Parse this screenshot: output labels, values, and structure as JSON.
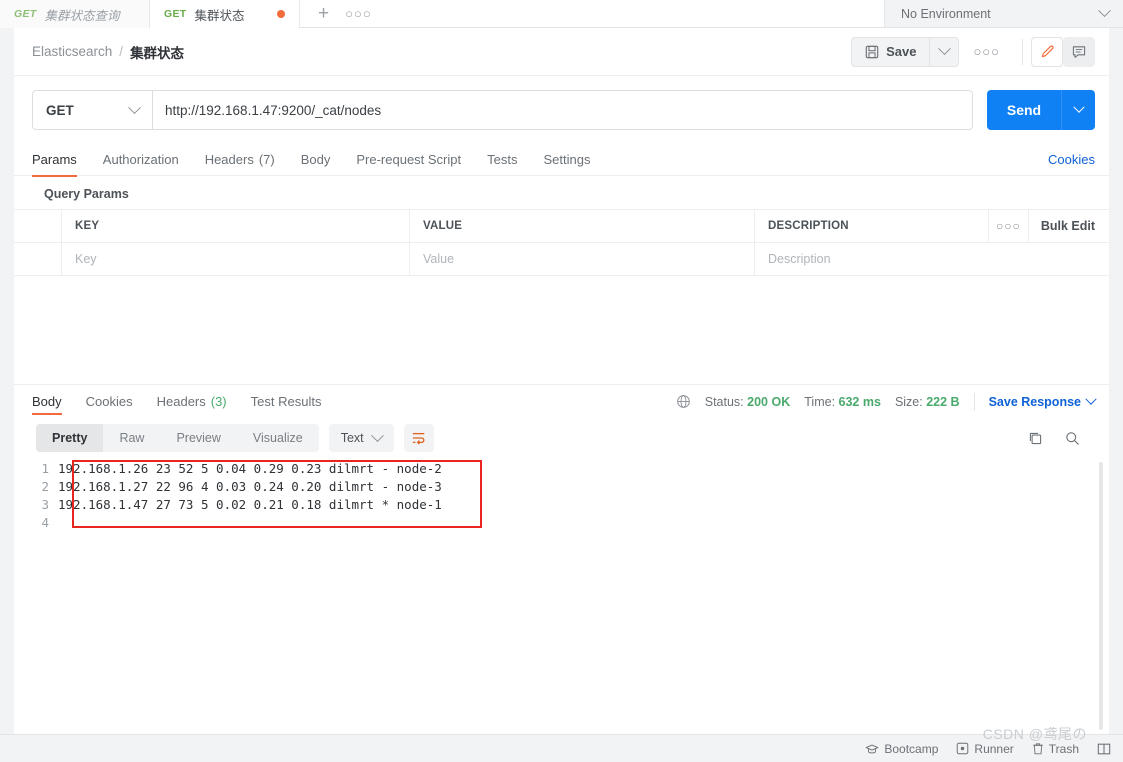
{
  "tabs": [
    {
      "method": "GET",
      "name": "集群状态查询",
      "active": false,
      "unsaved": false
    },
    {
      "method": "GET",
      "name": "集群状态",
      "active": true,
      "unsaved": true
    }
  ],
  "tabbar": {
    "new_tab_label": "+",
    "more_label": "○○○",
    "environment": "No Environment"
  },
  "header": {
    "breadcrumb_collection": "Elasticsearch",
    "breadcrumb_separator": "/",
    "breadcrumb_request": "集群状态",
    "save_label": "Save",
    "more_label": "○○○"
  },
  "request": {
    "method": "GET",
    "url": "http://192.168.1.47:9200/_cat/nodes",
    "send_label": "Send",
    "tabs": [
      {
        "label": "Params",
        "count": "",
        "active": true
      },
      {
        "label": "Authorization",
        "count": "",
        "active": false
      },
      {
        "label": "Headers",
        "count": "(7)",
        "active": false
      },
      {
        "label": "Body",
        "count": "",
        "active": false
      },
      {
        "label": "Pre-request Script",
        "count": "",
        "active": false
      },
      {
        "label": "Tests",
        "count": "",
        "active": false
      },
      {
        "label": "Settings",
        "count": "",
        "active": false
      }
    ],
    "cookies_link": "Cookies"
  },
  "params": {
    "section_title": "Query Params",
    "columns": [
      "KEY",
      "VALUE",
      "DESCRIPTION"
    ],
    "more_label": "○○○",
    "bulk_edit_label": "Bulk Edit",
    "empty_row": {
      "key": "Key",
      "value": "Value",
      "description": "Description"
    }
  },
  "response": {
    "tabs": [
      {
        "label": "Body",
        "count": "",
        "active": true
      },
      {
        "label": "Cookies",
        "count": "",
        "active": false
      },
      {
        "label": "Headers",
        "count": "(3)",
        "active": false
      },
      {
        "label": "Test Results",
        "count": "",
        "active": false
      }
    ],
    "status_label": "Status:",
    "status_value": "200 OK",
    "time_label": "Time:",
    "time_value": "632 ms",
    "size_label": "Size:",
    "size_value": "222 B",
    "save_response_label": "Save Response",
    "format_segments": [
      "Pretty",
      "Raw",
      "Preview",
      "Visualize"
    ],
    "format_active": "Pretty",
    "content_type": "Text",
    "line_numbers": [
      "1",
      "2",
      "3",
      "4"
    ],
    "body_lines": [
      "192.168.1.26 23 52 5 0.04 0.29 0.23 dilmrt - node-2",
      "192.168.1.27 22 96 4 0.03 0.24 0.20 dilmrt - node-3",
      "192.168.1.47 27 73 5 0.02 0.21 0.18 dilmrt * node-1",
      ""
    ]
  },
  "statusbar": {
    "bootcamp": "Bootcamp",
    "runner": "Runner",
    "trash": "Trash",
    "watermark": "CSDN @鸢尾の"
  },
  "colors": {
    "accent_orange": "#f26b3a",
    "send_blue": "#0f81f5",
    "link_blue": "#0f62d6",
    "success_green": "#4aa96c",
    "method_green": "#6aab4a",
    "highlight_red": "#e8261f"
  }
}
